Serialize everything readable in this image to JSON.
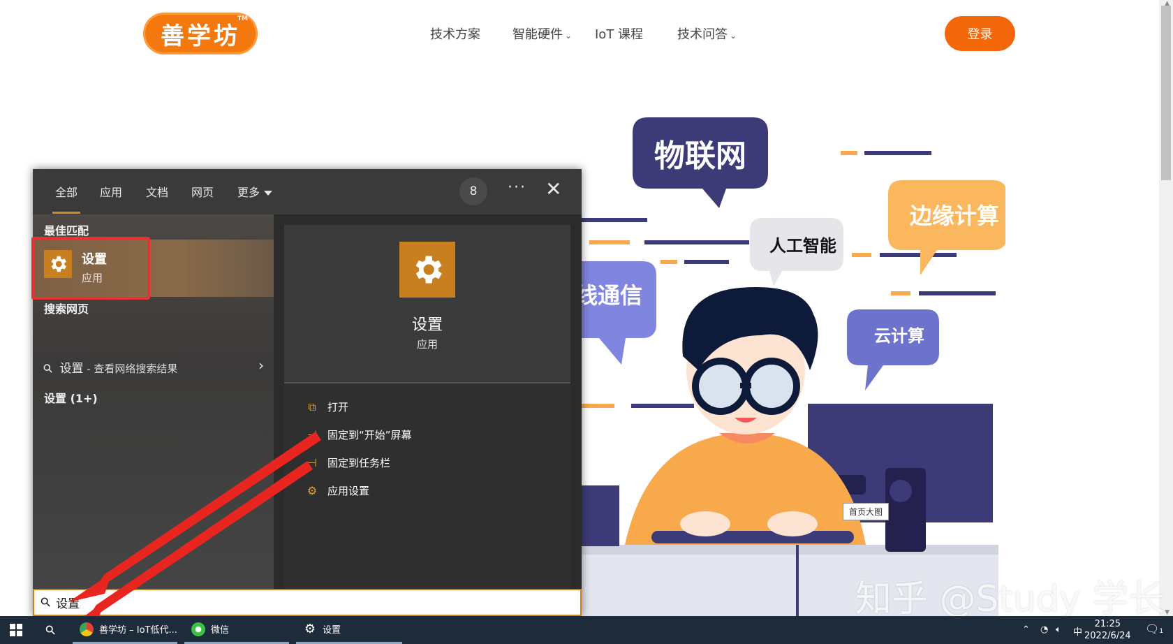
{
  "site": {
    "logo_text": "善学坊",
    "logo_tm": "TM",
    "nav": [
      "技术方案",
      "智能硬件",
      "IoT 课程",
      "技术问答"
    ],
    "login_label": "登录",
    "hero_labels": [
      "物联网",
      "人工智能",
      "边缘计算",
      "线通信",
      "云计算"
    ],
    "image_tooltip": "首页大图",
    "watermark": "知乎 @Study 学长"
  },
  "search": {
    "tabs": [
      "全部",
      "应用",
      "文档",
      "网页",
      "更多"
    ],
    "points_badge": "8",
    "more_options": "···",
    "close": "✕",
    "best_match_title": "最佳匹配",
    "best_match": {
      "name": "设置",
      "type": "应用"
    },
    "web_section_title": "搜索网页",
    "web_item": {
      "query": "设置",
      "suffix": " - 查看网络搜索结果"
    },
    "settings_group": "设置 (1+)",
    "detail": {
      "name": "设置",
      "type": "应用",
      "actions": [
        {
          "icon": "open-icon",
          "label": "打开"
        },
        {
          "icon": "pin-icon",
          "label": "固定到“开始”屏幕"
        },
        {
          "icon": "pin-icon",
          "label": "固定到任务栏"
        },
        {
          "icon": "gear-icon",
          "label": "应用设置"
        }
      ]
    },
    "query": "设置"
  },
  "taskbar": {
    "apps": [
      {
        "icon": "chrome-icon",
        "label": "善学坊 – IoT低代..."
      },
      {
        "icon": "wechat-icon",
        "label": "微信"
      },
      {
        "icon": "gear-icon",
        "label": "设置"
      }
    ],
    "ime": "中",
    "time": "21:25",
    "date": "2022/6/24",
    "notification_count": "1"
  },
  "colors": {
    "accent": "#c87f20",
    "brand_orange": "#f3790f",
    "highlight_red": "#e53232",
    "taskbar": "#1e2b3a"
  }
}
